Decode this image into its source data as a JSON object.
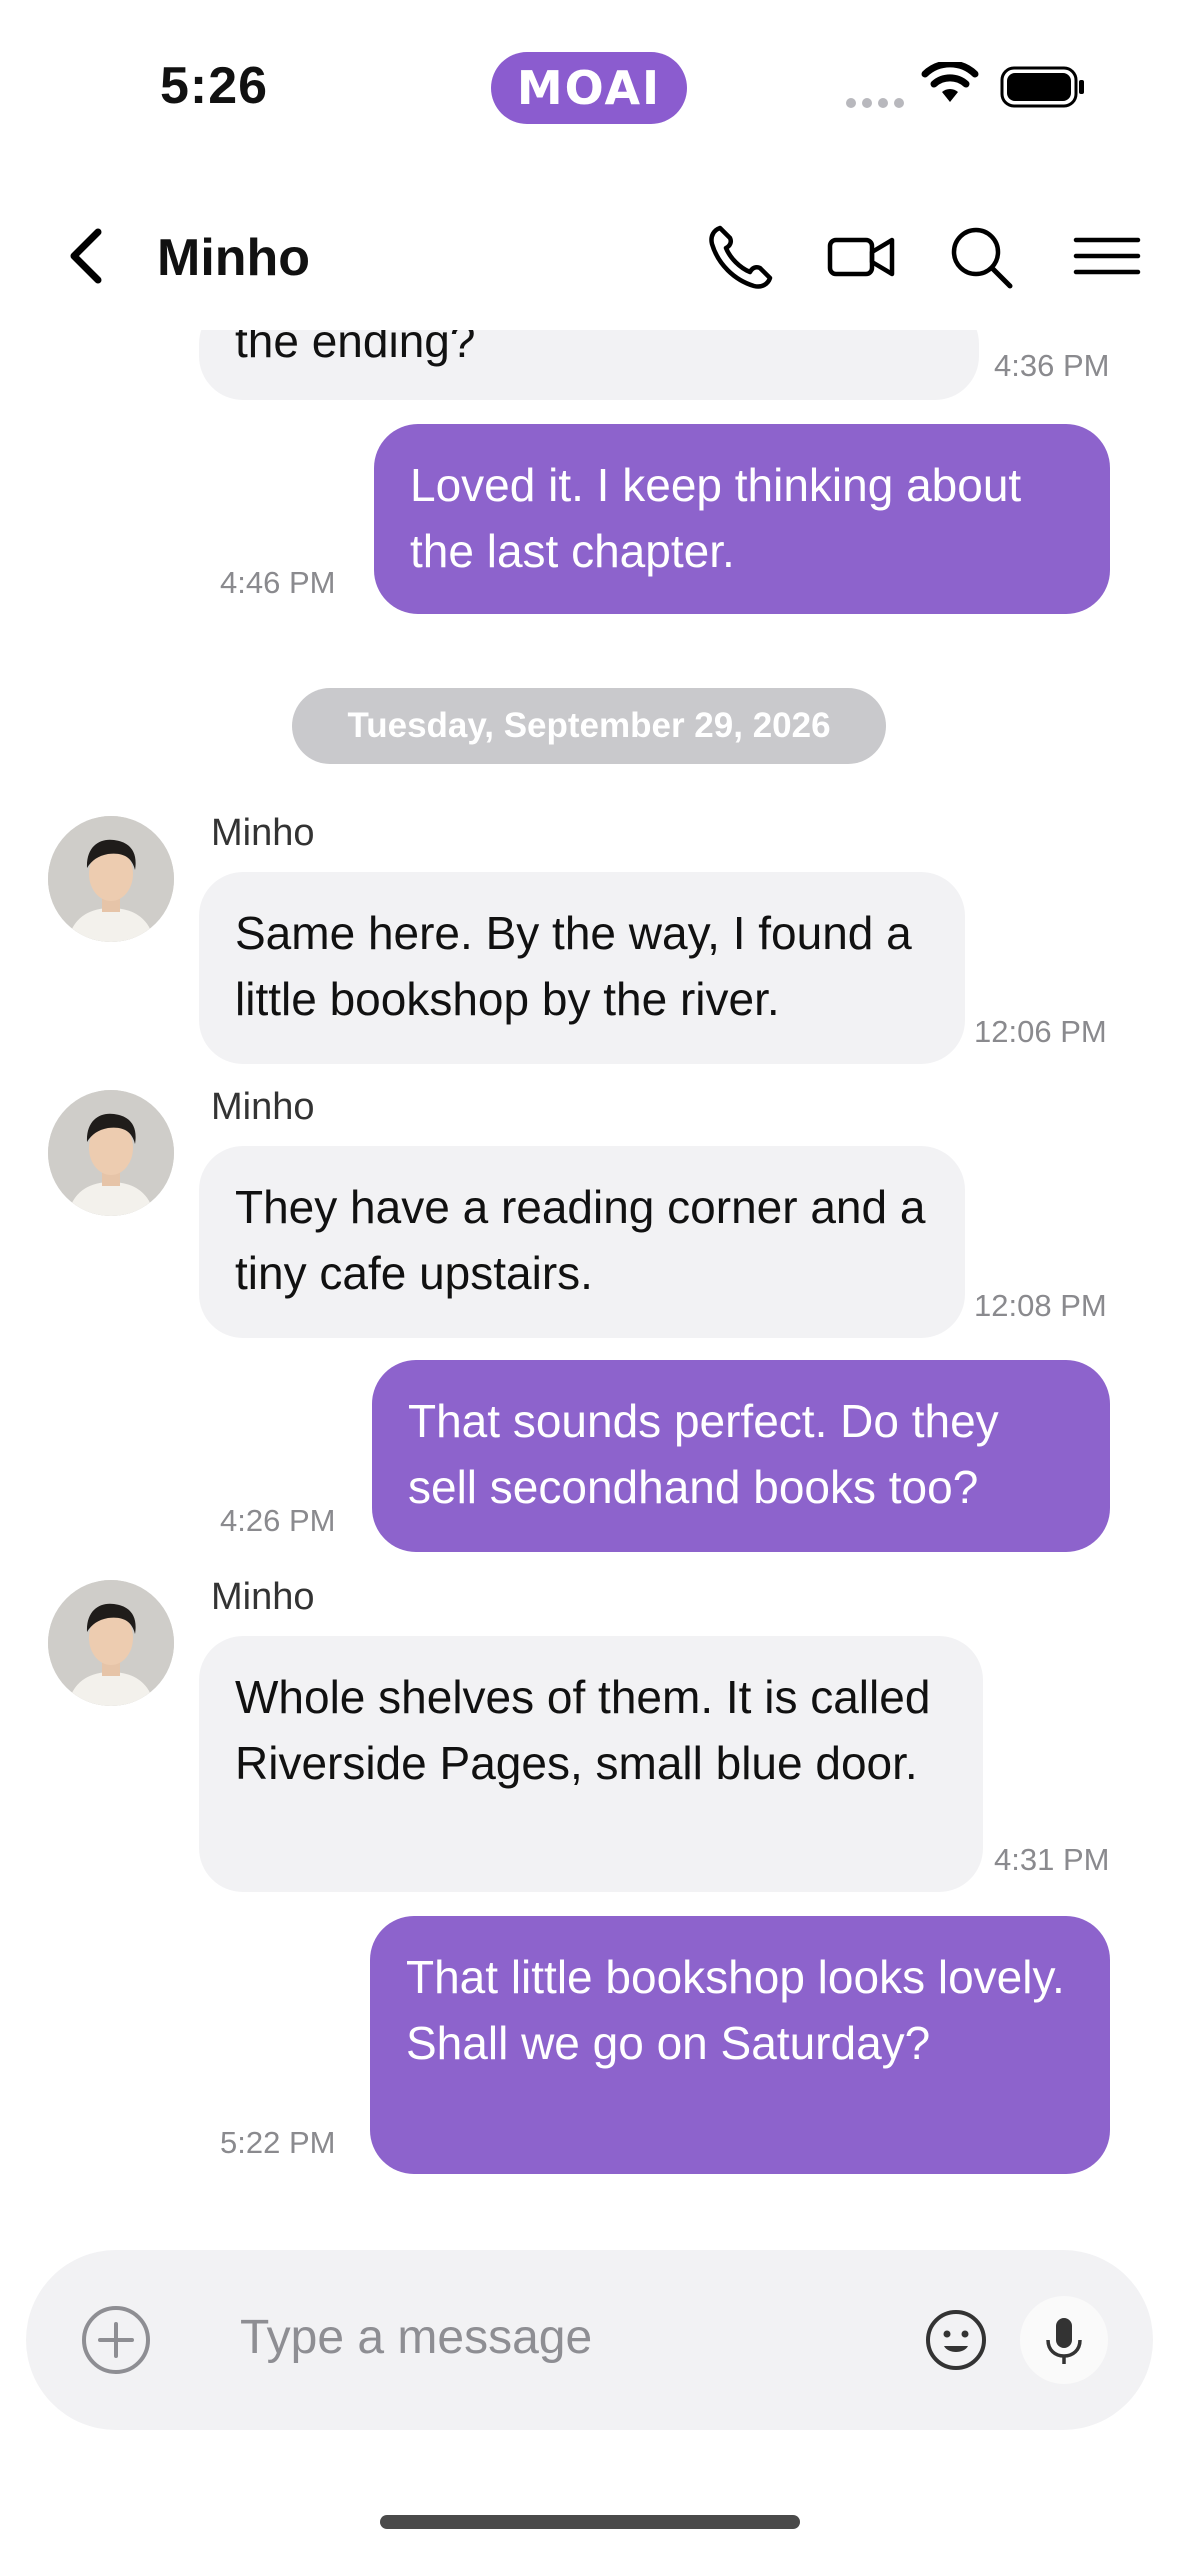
{
  "status_bar": {
    "time": "5:26",
    "app_badge": "MOAI"
  },
  "header": {
    "back_label": "Back",
    "contact_name": "Minho"
  },
  "date_separator": "Tuesday, September 29, 2026",
  "messages": [
    {
      "side": "in",
      "text": "the ending?",
      "time": "4:36 PM"
    },
    {
      "side": "out",
      "text": "Loved it. I keep thinking about the last chapter.",
      "time": "4:46 PM"
    },
    {
      "side": "in",
      "sender": "Minho",
      "text": "Same here. By the way, I found a little bookshop by the river.",
      "time": "12:06 PM"
    },
    {
      "side": "in",
      "sender": "Minho",
      "text": "They have a reading corner and a tiny cafe upstairs.",
      "time": "12:08 PM"
    },
    {
      "side": "out",
      "text": "That sounds perfect. Do they sell secondhand books too?",
      "time": "4:26 PM"
    },
    {
      "side": "in",
      "sender": "Minho",
      "text": "Whole shelves of them. It is called Riverside Pages, small blue door.",
      "time": "4:31 PM"
    },
    {
      "side": "out",
      "text": "That little bookshop looks lovely. Shall we go on Saturday?",
      "time": "5:22 PM"
    }
  ],
  "composer": {
    "placeholder": "Type a message"
  },
  "colors": {
    "accent": "#8d63cc",
    "incoming_bubble": "#f2f2f4",
    "date_pill": "#c9c9cc"
  }
}
